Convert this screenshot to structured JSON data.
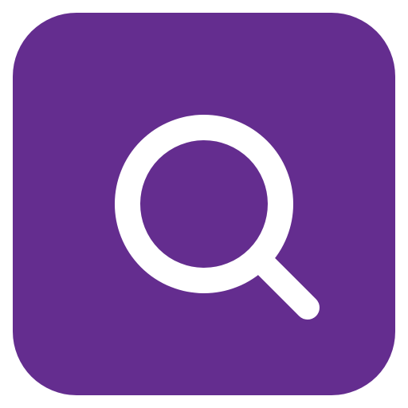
{
  "app_icon": {
    "icon": "search-icon",
    "colors": {
      "background": "#642D8F",
      "glyph": "#FFFFFF"
    }
  }
}
